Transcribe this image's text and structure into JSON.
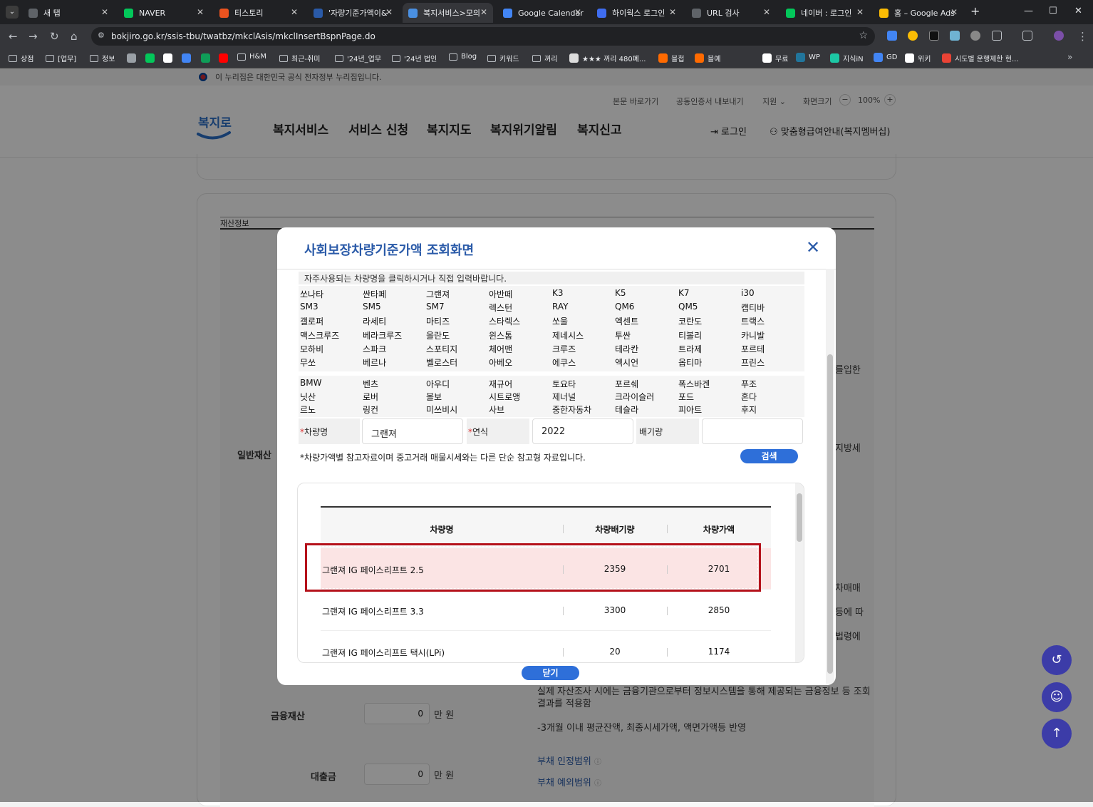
{
  "browser": {
    "tabs": [
      {
        "title": "새 탭",
        "color": "#5f6368"
      },
      {
        "title": "NAVER",
        "color": "#03c75a"
      },
      {
        "title": "티스토리",
        "color": "#eb531f"
      },
      {
        "title": "'자량기준가액이&",
        "color": "#2a5aa8"
      },
      {
        "title": "복지서비스>모의",
        "color": "#4a90e2"
      },
      {
        "title": "Google Calendar",
        "color": "#4285f4"
      },
      {
        "title": "하이웍스 로그인",
        "color": "#3f6df0"
      },
      {
        "title": "URL 검사",
        "color": "#5f6368"
      },
      {
        "title": "네이버 : 로그인",
        "color": "#03c75a"
      },
      {
        "title": "홈 – Google Ads",
        "color": "#fbbc04"
      }
    ],
    "url": "bokjiro.go.kr/ssis-tbu/twatbz/mkclAsis/mkclInsertBspnPage.do",
    "bookmarks": [
      "상점",
      "[업무]",
      "정보",
      "H&M",
      "최근-취미",
      "'24년_업무",
      "'24년 법인",
      "Blog",
      "키워드",
      "꺼리",
      "★★★ 꺼리 480폐...",
      "블첩",
      "블예",
      "무료",
      "WP",
      "지식iN",
      "GD",
      "위키",
      "시도별 운행제한 현..."
    ]
  },
  "site": {
    "gov_banner": "이 누리집은 대한민국 공식 전자정부 누리집입니다.",
    "utility": {
      "skip": "본문 바로가기",
      "cert": "공동인증서 내보내기",
      "support": "지원",
      "screen_size": "화면크기",
      "zoom": "100%"
    },
    "logo": "복지로",
    "nav": [
      "복지서비스",
      "서비스 신청",
      "복지지도",
      "복지위기알림",
      "복지신고"
    ],
    "login": "로그인",
    "membership": "맞춤형급여안내(복지멤버십)",
    "section_label": "재산정보",
    "general_asset": "일반재산",
    "right_snips": [
      "를입한",
      "지방세",
      "차매매",
      "등에 따",
      "법령에"
    ],
    "financial": {
      "label": "금융재산",
      "value": "0",
      "unit": "만 원",
      "note1": "실제 자산조사 시에는 금융기관으로부터 정보시스템을 통해 제공되는 금융정보 등 조회결과를 적용함",
      "note2": "-3개월 이내 평균잔액, 최종시세가액, 액면가액등 반영"
    },
    "loan": {
      "label": "대출금",
      "value": "0",
      "unit": "만 원",
      "link1": "부채 인정범위",
      "link2": "부채 예외범위"
    }
  },
  "modal": {
    "title": "사회보장차량기준가액 조회화면",
    "guide": "자주사용되는 차량명을 클릭하시거나 직접 입력바랍니다.",
    "domestic": [
      [
        "쏘나타",
        "싼타페",
        "그랜져",
        "아반떼",
        "K3",
        "K5",
        "K7",
        "i30"
      ],
      [
        "SM3",
        "SM5",
        "SM7",
        "렉스턴",
        "RAY",
        "QM6",
        "QM5",
        "캡티바"
      ],
      [
        "갤로퍼",
        "라세티",
        "마티즈",
        "스타렉스",
        "쏘울",
        "엑센트",
        "코란도",
        "트랙스"
      ],
      [
        "맥스크루즈",
        "베라크루즈",
        "올란도",
        "윈스톰",
        "제네시스",
        "투싼",
        "티볼리",
        "카니발"
      ],
      [
        "모하비",
        "스파크",
        "스포티지",
        "체어맨",
        "크루즈",
        "테라칸",
        "트라제",
        "포르테"
      ],
      [
        "무쏘",
        "베르나",
        "벨로스터",
        "아베오",
        "에쿠스",
        "엑시언",
        "옵티마",
        "프린스"
      ]
    ],
    "imported": [
      [
        "BMW",
        "벤츠",
        "아우디",
        "재규어",
        "토요타",
        "포르쉐",
        "폭스바겐",
        "푸조"
      ],
      [
        "닛산",
        "로버",
        "볼보",
        "시트로앵",
        "제너널",
        "크라이슬러",
        "포드",
        "혼다"
      ],
      [
        "르노",
        "링컨",
        "미쓰비시",
        "사브",
        "중한자동차",
        "테슬라",
        "피아트",
        "후지"
      ]
    ],
    "form": {
      "name_label": "차량명",
      "name_value": "그랜져",
      "year_label": "연식",
      "year_value": "2022",
      "cc_label": "배기량",
      "cc_value": ""
    },
    "note": "*차량가액별 참고자료이며 중고거래 매물시세와는 다른 단순 참고형 자료입니다.",
    "search_btn": "검색",
    "table": {
      "headers": [
        "차량명",
        "차량배기량",
        "차량가액"
      ],
      "rows": [
        [
          "그랜져 IG 페이스리프트 2.5",
          "2359",
          "2701"
        ],
        [
          "그랜져 IG 페이스리프트 3.3",
          "3300",
          "2850"
        ],
        [
          "그랜져 IG 페이스리프트 택시(LPi)",
          "20",
          "1174"
        ]
      ]
    },
    "close_btn": "닫기"
  }
}
